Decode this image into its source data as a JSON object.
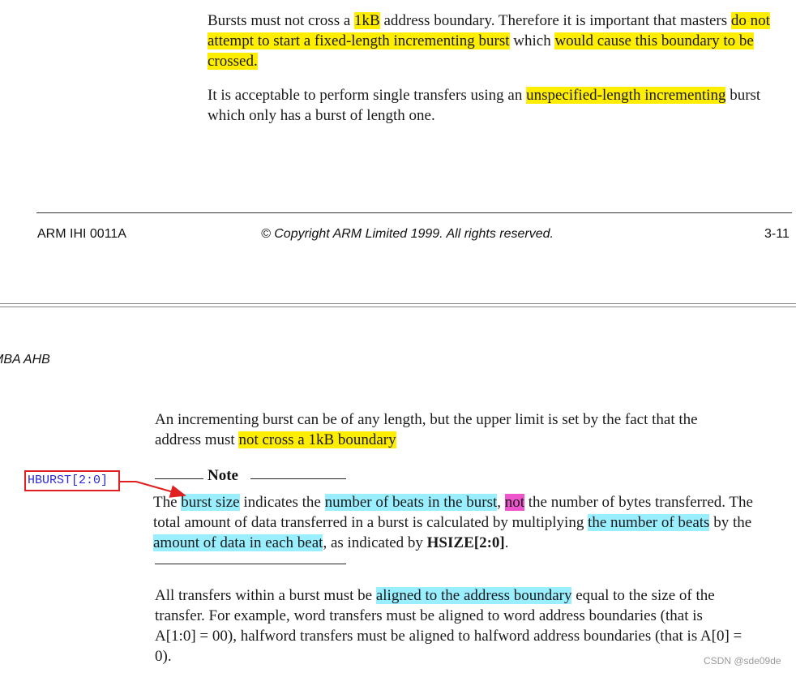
{
  "page1": {
    "para1": {
      "t1": "Bursts must not cross a ",
      "h1": "1kB",
      "t2": " address boundary. Therefore it is important that masters ",
      "h2": "do not attempt to start a fixed-length incrementing burst",
      "t3": " which ",
      "h3": "would cause this boundary to be crossed."
    },
    "para2": {
      "t1": "It is acceptable to perform single transfers using an ",
      "h1": "unspecified-length incrementing",
      "t2": " burst which only has a burst of length one."
    },
    "footer": {
      "left": "ARM IHI 0011A",
      "center": "© Copyright ARM Limited 1999. All rights reserved.",
      "right": "3-11"
    }
  },
  "page2": {
    "header_left": "MBA AHB",
    "para3": {
      "t1": "An incrementing burst can be of any length, but the upper limit is set by the fact that the address must ",
      "h1": "not cross a 1kB boundary"
    },
    "note": {
      "title": "Note",
      "t1": "The ",
      "c1": "burst size",
      "t2": " indicates the ",
      "c2": "number of beats in the burst",
      "t3": ", ",
      "m1": "not",
      "t4": " the number of bytes transferred. The total amount of data transferred in a burst is calculated by multiplying ",
      "c3": "the number of beats",
      "t5": " by the ",
      "c4": "amount of data in each beat",
      "t6": ", as indicated by ",
      "b1": "HSIZE[2:0]",
      "t7": "."
    },
    "para4": {
      "t1": "All transfers within a burst must be ",
      "c1": "aligned to the address boundary",
      "t2": " equal to the size of the transfer. For example, word transfers must be aligned to word address boundaries (that is A[1:0] = 00), halfword transfers must be aligned to halfword address boundaries (that is A[0] = 0)."
    }
  },
  "annotation": {
    "label": "HBURST[2:0]"
  },
  "watermark": "CSDN @sde09de",
  "colors": {
    "highlight_yellow": "#ffee00",
    "highlight_cyan": "#99efff",
    "highlight_magenta": "#ee55cc",
    "annotation_red": "#e02020",
    "annotation_text_blue": "#2a2ad8"
  }
}
